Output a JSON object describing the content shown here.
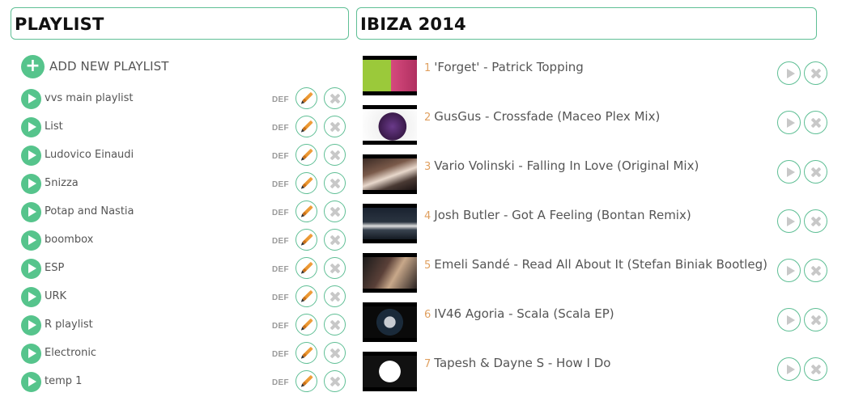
{
  "playlist_panel": {
    "title": "PLAYLIST",
    "add_label": "ADD NEW PLAYLIST",
    "add_icon": "+",
    "def_label": "DEF",
    "items": [
      {
        "name": "vvs main playlist"
      },
      {
        "name": "List"
      },
      {
        "name": "Ludovico Einaudi"
      },
      {
        "name": "5nizza"
      },
      {
        "name": "Potap and Nastia"
      },
      {
        "name": "boombox"
      },
      {
        "name": "ESP"
      },
      {
        "name": "URK"
      },
      {
        "name": "R playlist"
      },
      {
        "name": "Electronic"
      },
      {
        "name": "temp 1"
      }
    ]
  },
  "tracks_panel": {
    "title": "IBIZA 2014",
    "tracks": [
      {
        "num": "1",
        "title": "'Forget' - Patrick Topping"
      },
      {
        "num": "2",
        "title": "GusGus - Crossfade (Maceo Plex Mix)"
      },
      {
        "num": "3",
        "title": "Vario Volinski - Falling In Love (Original Mix)"
      },
      {
        "num": "4",
        "title": "Josh Butler - Got A Feeling (Bontan Remix)"
      },
      {
        "num": "5",
        "title": "Emeli Sandé - Read All About It (Stefan Biniak Bootleg)"
      },
      {
        "num": "6",
        "title": "IV46 Agoria - Scala (Scala EP)"
      },
      {
        "num": "7",
        "title": "Tapesh & Dayne S - How I Do"
      }
    ]
  },
  "colors": {
    "accent": "#56c48c",
    "border": "#5fbf95",
    "muted_icon": "#c8c8c8",
    "track_number": "#e0a060"
  },
  "icons": {
    "add": "plus-icon",
    "play": "play-icon",
    "edit": "pencil-icon",
    "delete": "close-icon"
  }
}
